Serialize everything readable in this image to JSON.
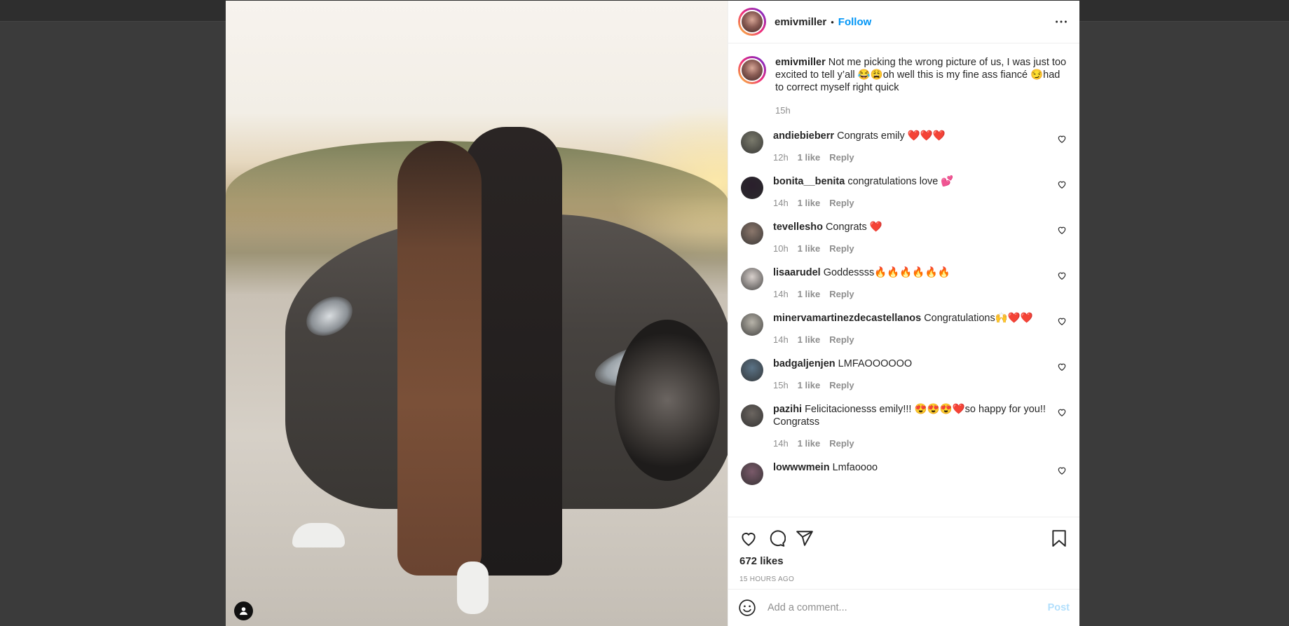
{
  "post": {
    "username": "emivmiller",
    "separator": "•",
    "follow_label": "Follow",
    "caption_username": "emivmiller",
    "caption_text": "Not me picking the wrong picture of us, I was just too excited to tell y’all 😂😩oh well this is my fine ass fiancé 😏had to correct myself right quick",
    "caption_time": "15h",
    "likes": "672 likes",
    "posted_ago": "15 HOURS AGO"
  },
  "comments": [
    {
      "user": "andiebieberr",
      "text": "Congrats emily ❤️❤️❤️",
      "time": "12h",
      "likes": "1 like",
      "reply": "Reply",
      "avatar_color": "#7a7a6c"
    },
    {
      "user": "bonita__benita",
      "text": "congratulations love 💕",
      "time": "14h",
      "likes": "1 like",
      "reply": "Reply",
      "avatar_color": "#2a1f2c"
    },
    {
      "user": "tevellesho",
      "text": "Congrats ❤️",
      "time": "10h",
      "likes": "1 like",
      "reply": "Reply",
      "avatar_color": "#8b776c"
    },
    {
      "user": "lisaarudel",
      "text": "Goddessss🔥🔥🔥🔥🔥🔥",
      "time": "14h",
      "likes": "1 like",
      "reply": "Reply",
      "avatar_color": "#d8d0cc"
    },
    {
      "user": "minervamartinezdecastellanos",
      "text": "Congratulations🙌❤️❤️",
      "time": "14h",
      "likes": "1 like",
      "reply": "Reply",
      "avatar_color": "#b8b4aa"
    },
    {
      "user": "badgaljenjen",
      "text": "LMFAOOOOOO",
      "time": "15h",
      "likes": "1 like",
      "reply": "Reply",
      "avatar_color": "#5b7386"
    },
    {
      "user": "pazihi",
      "text": "Felicitacionesss emily!!! 😍😍😍❤️so happy for you!! Congratss",
      "time": "14h",
      "likes": "1 like",
      "reply": "Reply",
      "avatar_color": "#6b6560"
    },
    {
      "user": "lowwwmein",
      "text": "Lmfaoooo",
      "time": "",
      "likes": "",
      "reply": "",
      "avatar_color": "#7a5a6a"
    }
  ],
  "add_comment": {
    "placeholder": "Add a comment...",
    "post_label": "Post"
  },
  "icons": [
    "more-icon",
    "heart-icon",
    "comment-icon",
    "share-icon",
    "bookmark-icon",
    "smile-icon",
    "user-tag-icon"
  ],
  "colors": {
    "accent": "#0095f6",
    "text": "#262626",
    "muted": "#8e8e8e",
    "post_disabled": "#b2dffc"
  }
}
